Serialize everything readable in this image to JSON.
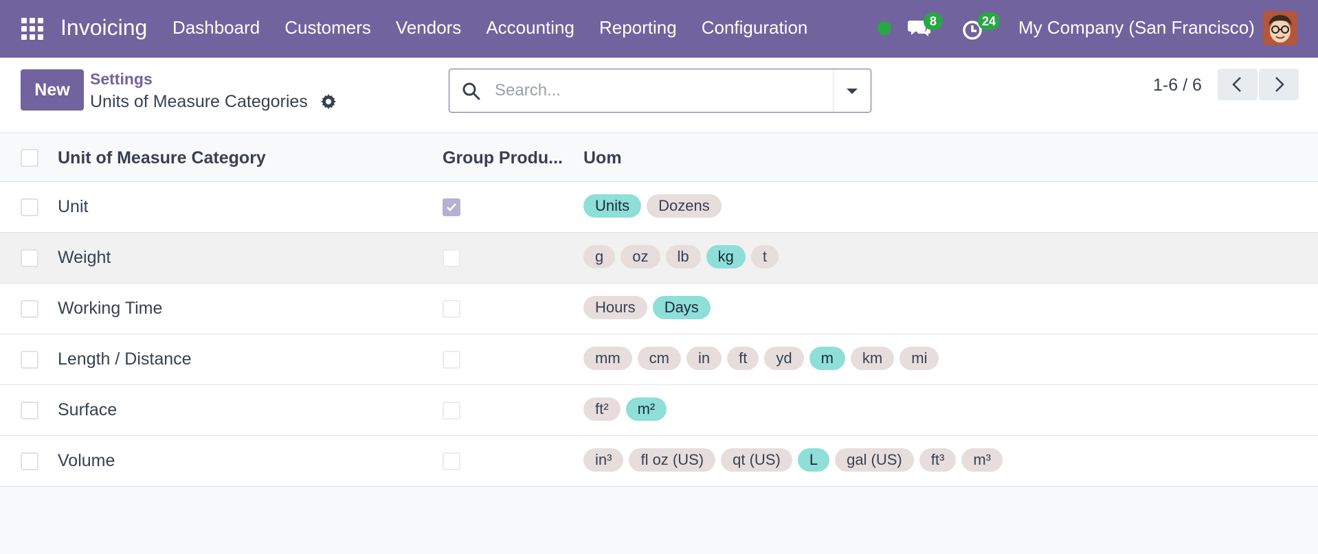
{
  "navbar": {
    "app_name": "Invoicing",
    "menu": [
      "Dashboard",
      "Customers",
      "Vendors",
      "Accounting",
      "Reporting",
      "Configuration"
    ],
    "messages_count": "8",
    "activities_count": "24",
    "company": "My Company (San Francisco)",
    "status_color": "#28a745",
    "brand_color": "#71639e"
  },
  "control": {
    "new_label": "New",
    "breadcrumb_parent": "Settings",
    "page_title": "Units of Measure Categories",
    "search_placeholder": "Search...",
    "pager": "1-6 / 6"
  },
  "table": {
    "columns": [
      "Unit of Measure Category",
      "Group Produ...",
      "Uom"
    ],
    "rows": [
      {
        "name": "Unit",
        "group": true,
        "uoms": [
          {
            "label": "Units",
            "ref": true
          },
          {
            "label": "Dozens",
            "ref": false
          }
        ]
      },
      {
        "name": "Weight",
        "group": false,
        "uoms": [
          {
            "label": "g",
            "ref": false
          },
          {
            "label": "oz",
            "ref": false
          },
          {
            "label": "lb",
            "ref": false
          },
          {
            "label": "kg",
            "ref": true
          },
          {
            "label": "t",
            "ref": false
          }
        ]
      },
      {
        "name": "Working Time",
        "group": false,
        "uoms": [
          {
            "label": "Hours",
            "ref": false
          },
          {
            "label": "Days",
            "ref": true
          }
        ]
      },
      {
        "name": "Length / Distance",
        "group": false,
        "uoms": [
          {
            "label": "mm",
            "ref": false
          },
          {
            "label": "cm",
            "ref": false
          },
          {
            "label": "in",
            "ref": false
          },
          {
            "label": "ft",
            "ref": false
          },
          {
            "label": "yd",
            "ref": false
          },
          {
            "label": "m",
            "ref": true
          },
          {
            "label": "km",
            "ref": false
          },
          {
            "label": "mi",
            "ref": false
          }
        ]
      },
      {
        "name": "Surface",
        "group": false,
        "uoms": [
          {
            "label": "ft²",
            "ref": false
          },
          {
            "label": "m²",
            "ref": true
          }
        ]
      },
      {
        "name": "Volume",
        "group": false,
        "uoms": [
          {
            "label": "in³",
            "ref": false
          },
          {
            "label": "fl oz (US)",
            "ref": false
          },
          {
            "label": "qt (US)",
            "ref": false
          },
          {
            "label": "L",
            "ref": true
          },
          {
            "label": "gal (US)",
            "ref": false
          },
          {
            "label": "ft³",
            "ref": false
          },
          {
            "label": "m³",
            "ref": false
          }
        ]
      }
    ]
  }
}
